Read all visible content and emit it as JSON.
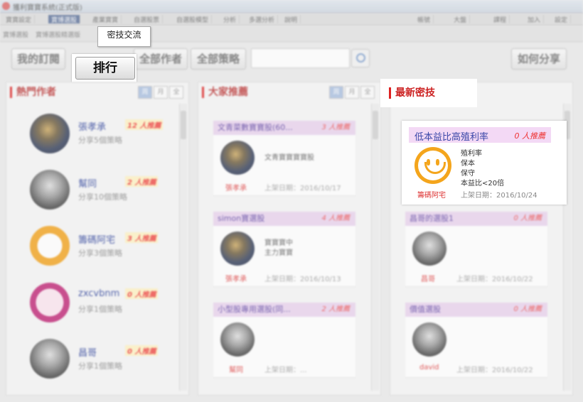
{
  "app": {
    "title": "獲利寶寶系統(正式版)"
  },
  "menu": {
    "tabs": [
      "寶寶設定",
      "寶博選股",
      "產業寶寶",
      "自選股票",
      "自選股模型",
      "分析",
      "多選分析",
      "說明"
    ],
    "right": [
      "帳號",
      "大盤",
      "課程",
      "加入",
      "設定"
    ]
  },
  "subtabs": [
    "寶博選股",
    "寶博選股精選版"
  ],
  "tab_popup": {
    "label": "密技交流"
  },
  "toolbar": {
    "my_subs": "我的訂閱",
    "rank": "排行",
    "all_authors": "全部作者",
    "all_strategies": "全部策略",
    "search_placeholder": "",
    "how_share": "如何分享"
  },
  "panels": {
    "hot_authors": {
      "title": "熱門作者",
      "ranges": [
        "周",
        "月",
        "全"
      ],
      "items": [
        {
          "name": "張孝承",
          "sub": "分享5個策略",
          "count": "12 人推薦",
          "av": "dark"
        },
        {
          "name": "幫同",
          "sub": "分享10個策略",
          "count": "2 人推薦",
          "av": "gray"
        },
        {
          "name": "籌碼阿宅",
          "sub": "分享3個策略",
          "count": "3 人推薦",
          "av": "smile"
        },
        {
          "name": "zxcvbnm",
          "sub": "分享1個策略",
          "count": "0 人推薦",
          "av": "pink"
        },
        {
          "name": "昌哥",
          "sub": "分享1個策略",
          "count": "0 人推薦",
          "av": "gray"
        }
      ]
    },
    "recommended": {
      "title": "大家推薦",
      "ranges": [
        "周",
        "月",
        "全"
      ],
      "items": [
        {
          "title": "文青菜數寶寶股(60...",
          "count": "3 人推薦",
          "desc": "文青寶寶寶寶股",
          "author": "張孝承",
          "date": "上架日期：2016/10/17",
          "av": "dark"
        },
        {
          "title": "simon寶選股",
          "count": "4 人推薦",
          "desc": "寶寶寶中\n主力寶寶",
          "author": "張孝承",
          "date": "上架日期：2016/10/13",
          "av": "dark"
        },
        {
          "title": "小型股專用選股(同...",
          "count": "2 人推薦",
          "desc": "",
          "author": "幫同",
          "date": "上架日期：...",
          "av": "gray"
        }
      ]
    },
    "latest": {
      "title": "最新密技",
      "card": {
        "title": "低本益比高殖利率",
        "count": "0 人推薦",
        "lines": [
          "殖利率",
          "保本",
          "保守",
          "本益比<20倍"
        ],
        "author": "籌碼阿宅",
        "date": "上架日期：2016/10/24"
      },
      "items": [
        {
          "title": "昌哥的選股1",
          "count": "0 人推薦",
          "author": "昌哥",
          "date": "上架日期：2016/10/22"
        },
        {
          "title": "價值選股",
          "count": "0 人推薦",
          "author": "david",
          "date": "上架日期：2016/10/22"
        }
      ]
    }
  },
  "colors": {
    "accent_red": "#dd2222",
    "title_blue": "#3a47a8",
    "card_pink": "#f3d9f5",
    "smile_orange": "#f4a51c"
  }
}
